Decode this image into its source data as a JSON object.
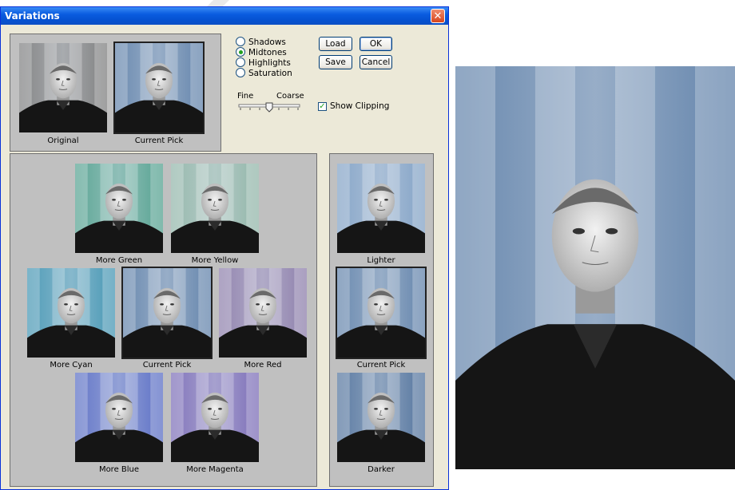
{
  "dialog": {
    "title": "Variations",
    "close_glyph": "✕"
  },
  "top": {
    "original_label": "Original",
    "current_pick_label": "Current Pick"
  },
  "tonal_range": [
    {
      "label": "Shadows",
      "selected": false
    },
    {
      "label": "Midtones",
      "selected": true
    },
    {
      "label": "Highlights",
      "selected": false
    },
    {
      "label": "Saturation",
      "selected": false
    }
  ],
  "buttons": {
    "load": "Load",
    "ok": "OK",
    "save": "Save",
    "cancel": "Cancel"
  },
  "slider": {
    "fine_label": "Fine",
    "coarse_label": "Coarse",
    "level": 0.5
  },
  "show_clipping": {
    "label": "Show Clipping",
    "checked": true,
    "mark": "✓"
  },
  "hue_variations": {
    "more_green": "More Green",
    "more_yellow": "More Yellow",
    "more_cyan": "More Cyan",
    "current_pick": "Current Pick",
    "more_red": "More Red",
    "more_blue": "More Blue",
    "more_magenta": "More Magenta"
  },
  "lightness_variations": {
    "lighter": "Lighter",
    "current_pick": "Current Pick",
    "darker": "Darker"
  },
  "tints": {
    "original": "#7b7b7b",
    "current": "#5d7fa8",
    "green": "#4f9f8c",
    "yellow": "#8fb4a6",
    "cyan": "#3f93b1",
    "red": "#8a7aa8",
    "blue": "#5569c3",
    "magenta": "#7868b5",
    "lighter": "#7e9fc4",
    "darker": "#4c6e99"
  }
}
